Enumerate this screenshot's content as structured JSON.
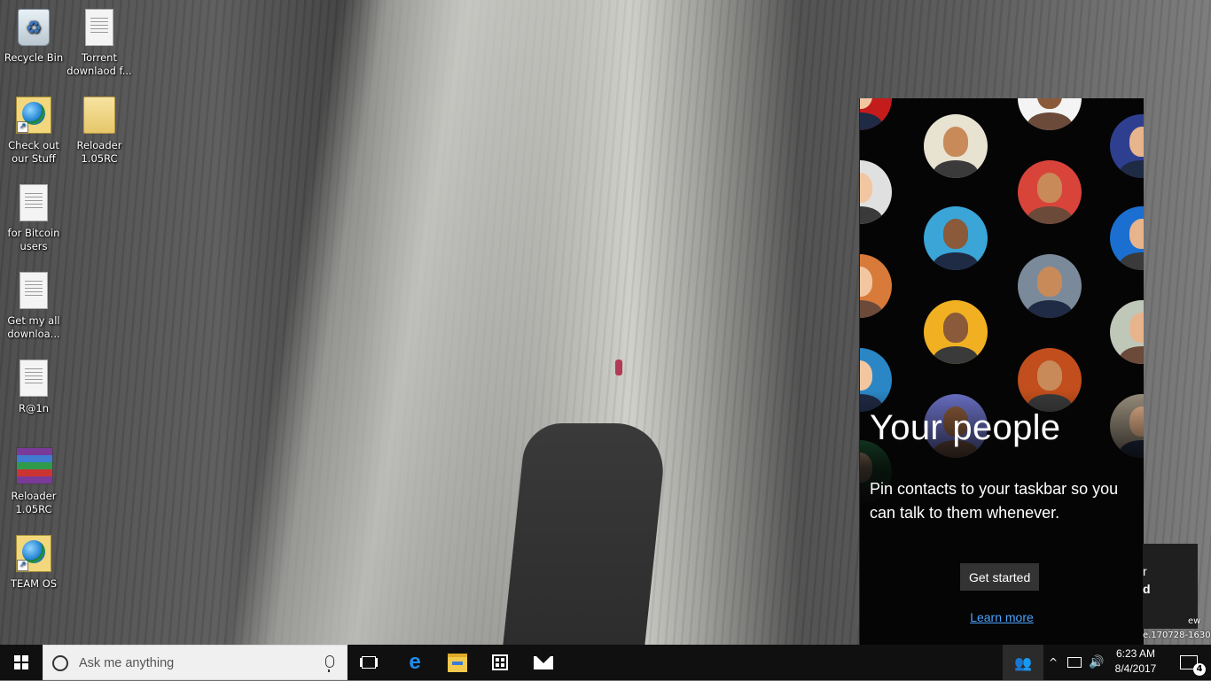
{
  "desktop": {
    "icons": [
      {
        "label": "Recycle Bin",
        "icon": "recycle-bin-icon"
      },
      {
        "label": "Torrent downlaod f...",
        "icon": "text-document-icon"
      },
      {
        "label": "Check out our Stuff",
        "icon": "internet-shortcut-icon"
      },
      {
        "label": "Reloader 1.05RC",
        "icon": "folder-icon"
      },
      {
        "label": "for Bitcoin users",
        "icon": "text-document-icon"
      },
      {
        "label": "Get my all downloa...",
        "icon": "text-document-icon"
      },
      {
        "label": "R@1n",
        "icon": "text-document-icon"
      },
      {
        "label": "Reloader 1.05RC",
        "icon": "winrar-archive-icon"
      },
      {
        "label": "TEAM OS",
        "icon": "internet-shortcut-icon"
      }
    ]
  },
  "people_flyout": {
    "title": "Your people",
    "description": "Pin contacts to your taskbar so you can talk to them whenever.",
    "get_started_label": "Get started",
    "learn_more_label": "Learn more",
    "avatar_colors": [
      "#c41c1c",
      "#e8e2d0",
      "#f4f4f4",
      "#2f3f8f",
      "#e0e0e0",
      "#d9443a",
      "#3aa5d6",
      "#1a6fd1",
      "#d87a3a",
      "#7b8a9a",
      "#f1b021",
      "#bfc7b8",
      "#2a86c4",
      "#c14e1c",
      "#6a70c4",
      "#9a8f7d",
      "#1f6b3c"
    ]
  },
  "notification_partial": {
    "line1": "r",
    "line2": "d",
    "watermark_top": "ew",
    "watermark_bottom": "e.170728-1630"
  },
  "taskbar": {
    "search_placeholder": "Ask me anything",
    "edge_glyph": "e",
    "people_glyph": "👥",
    "tray_chevron": "^",
    "volume_glyph": "🔊",
    "time": "6:23 AM",
    "date": "8/4/2017",
    "notification_count": "4"
  }
}
